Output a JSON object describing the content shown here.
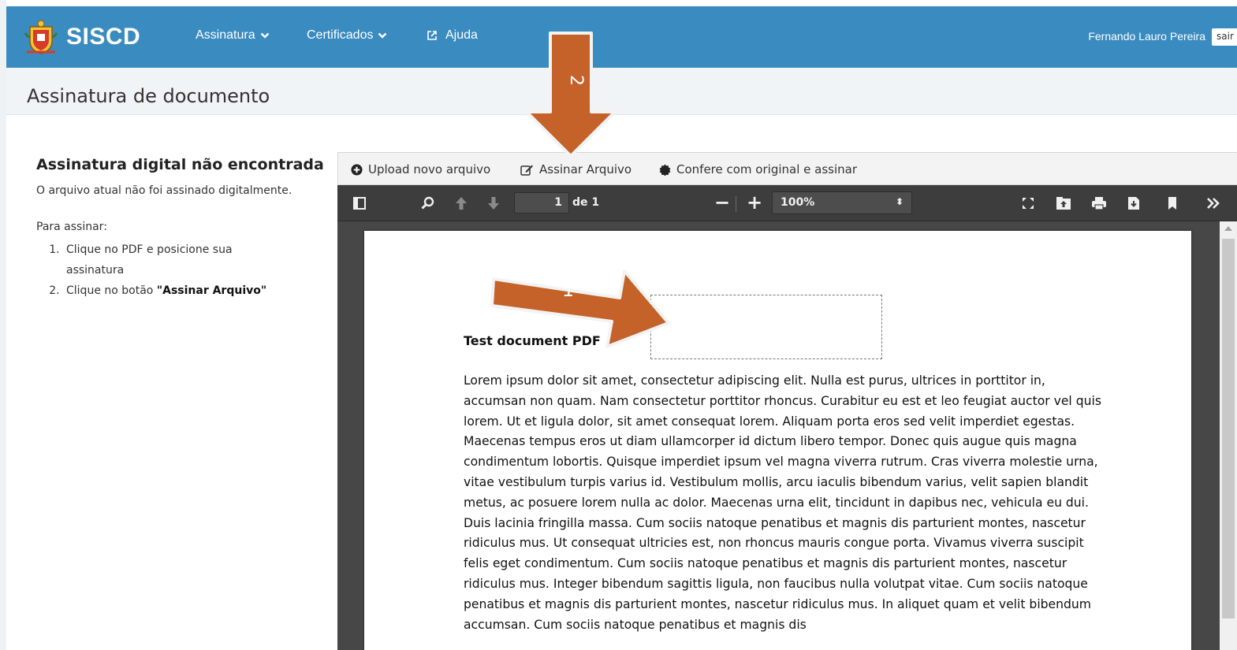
{
  "app": {
    "brand": "SISCD",
    "nav": [
      {
        "label": "Assinatura",
        "icon": "chevron-down-icon"
      },
      {
        "label": "Certificados",
        "icon": "chevron-down-icon"
      },
      {
        "label": "Ajuda",
        "icon": "external-link-icon"
      }
    ],
    "user_name": "Fernando Lauro Pereira",
    "logout_label": "sair",
    "colors": {
      "navbar": "#3a8bbf",
      "arrow": "#c4622a"
    }
  },
  "page": {
    "title": "Assinatura de documento"
  },
  "sidebar": {
    "heading": "Assinatura digital não encontrada",
    "message": "O arquivo atual não foi assinado digitalmente.",
    "howto_label": "Para assinar:",
    "step1": "Clique no PDF e posicione sua assinatura",
    "step2_prefix": "Clique no botão ",
    "step2_bold": "\"Assinar Arquivo\""
  },
  "toolbar": {
    "upload_label": "Upload novo arquivo",
    "sign_label": "Assinar Arquivo",
    "confirm_label": "Confere com original e assinar"
  },
  "pdf_toolbar": {
    "page_number": "1",
    "page_of": "de 1",
    "zoom_minus": "−",
    "zoom_plus": "+",
    "zoom_value": "100%"
  },
  "document": {
    "heading": "Test document PDF",
    "body": "Lorem ipsum dolor sit amet, consectetur adipiscing elit. Nulla est purus, ultrices in porttitor in, accumsan non quam. Nam consectetur porttitor rhoncus. Curabitur eu est et leo feugiat auctor vel quis lorem. Ut et ligula dolor, sit amet consequat lorem. Aliquam porta eros sed velit imperdiet egestas. Maecenas tempus eros ut diam ullamcorper id dictum libero tempor. Donec quis augue quis magna condimentum lobortis. Quisque imperdiet ipsum vel magna viverra rutrum. Cras viverra molestie urna, vitae vestibulum turpis varius id. Vestibulum mollis, arcu iaculis bibendum varius, velit sapien blandit metus, ac posuere lorem nulla ac dolor. Maecenas urna elit, tincidunt in dapibus nec, vehicula eu dui. Duis lacinia fringilla massa. Cum sociis natoque penatibus et magnis dis parturient montes, nascetur ridiculus mus. Ut consequat ultricies est, non rhoncus mauris congue porta. Vivamus viverra suscipit felis eget condimentum. Cum sociis natoque penatibus et magnis dis parturient montes, nascetur ridiculus mus. Integer bibendum sagittis ligula, non faucibus nulla volutpat vitae. Cum sociis natoque penatibus et magnis dis parturient montes, nascetur ridiculus mus. In aliquet quam et velit bibendum accumsan. Cum sociis natoque penatibus et magnis dis"
  },
  "annotations": {
    "arrow1_label": "1",
    "arrow2_label": "2"
  }
}
